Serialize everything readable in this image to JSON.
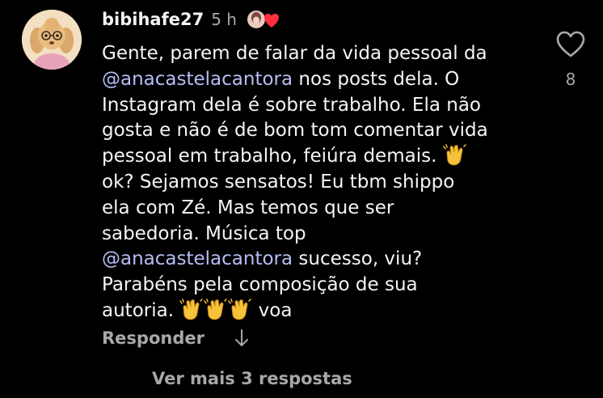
{
  "comment": {
    "username": "bibihafe27",
    "timestamp": "5 h",
    "body": {
      "line1": "Gente, parem de falar da vida pessoal da",
      "mention1": "@anacastelacantora",
      "line2_rest": " nos posts dela. O",
      "line3": "Instagram dela é sobre trabalho. Ela não",
      "line4": "gosta e não é de bom tom comentar vida",
      "line5": "pessoal em trabalho, feiúra demais. ",
      "line6": "ok? Sejamos sensatos! Eu tbm shippo",
      "line7": "ela com Zé. Mas temos que ser",
      "line8": "sabedoria.  Música top",
      "mention2": "@anacastelacantora",
      "line9_rest": " sucesso, viu?",
      "line10": "Parabéns pela composição de sua",
      "line11_start": "autoria. ",
      "line11_end": " voa"
    },
    "like_count": "8",
    "reply_label": "Responder",
    "view_replies_label": "Ver mais 3 respostas"
  },
  "colors": {
    "background": "#000000",
    "text": "#f5f5f5",
    "muted": "#a8a8a8",
    "mention": "#b6bdf5",
    "heart": "#ff3040"
  },
  "icons": {
    "emoji": "clapping-hands",
    "like": "heart-outline",
    "creator_like": "creator-avatar-with-red-heart",
    "translate": "down-arrow"
  }
}
